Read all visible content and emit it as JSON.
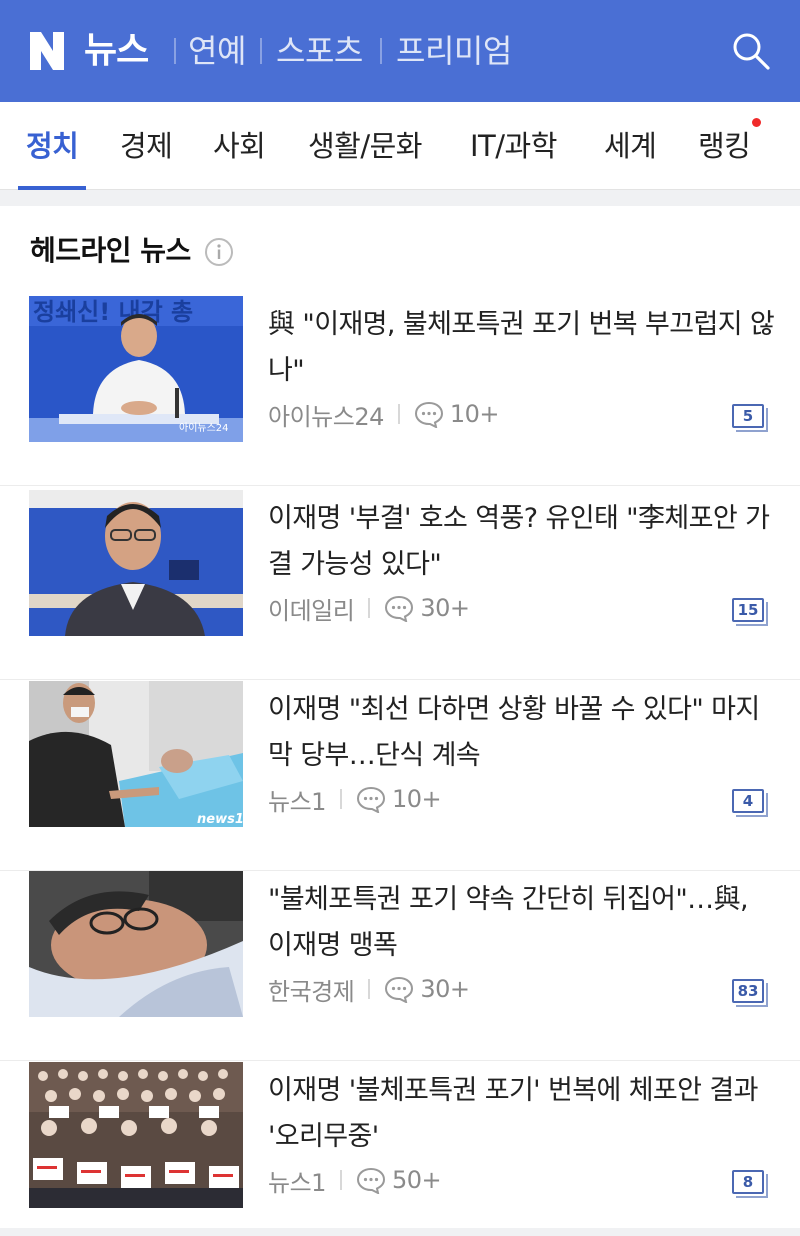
{
  "header": {
    "logo_letter": "N",
    "brand": "뉴스",
    "sections": [
      "연예",
      "스포츠",
      "프리미엄"
    ],
    "accent": "#4a6fd4"
  },
  "tabs": [
    {
      "label": "정치",
      "active": true
    },
    {
      "label": "경제"
    },
    {
      "label": "사회"
    },
    {
      "label": "생활/문화"
    },
    {
      "label": "IT/과학"
    },
    {
      "label": "세계"
    },
    {
      "label": "랭킹",
      "has_dot": true
    }
  ],
  "headline": {
    "title": "헤드라인 뉴스",
    "info_icon": "info-icon",
    "items": [
      {
        "title": "與 \"이재명, 불체포특권 포기 번복 부끄럽지 않나\"",
        "source": "아이뉴스24",
        "comments": "10+",
        "related": "5",
        "thumb_caption": "아이뉴스24",
        "thumb_banner": "정쇄신! 내각 총"
      },
      {
        "title": "이재명 '부결' 호소 역풍? 유인태 \"李체포안 가결 가능성 있다\"",
        "source": "이데일리",
        "comments": "30+",
        "related": "15"
      },
      {
        "title": "이재명 \"최선 다하면 상황 바꿀 수 있다\" 마지막 당부…단식 계속",
        "source": "뉴스1",
        "comments": "10+",
        "related": "4",
        "thumb_caption": "news1"
      },
      {
        "title": "\"불체포특권 포기 약속 간단히 뒤집어\"…與, 이재명 맹폭",
        "source": "한국경제",
        "comments": "30+",
        "related": "83"
      },
      {
        "title": "이재명 '불체포특권 포기' 번복에 체포안 결과 '오리무중'",
        "source": "뉴스1",
        "comments": "50+",
        "related": "8"
      }
    ]
  }
}
